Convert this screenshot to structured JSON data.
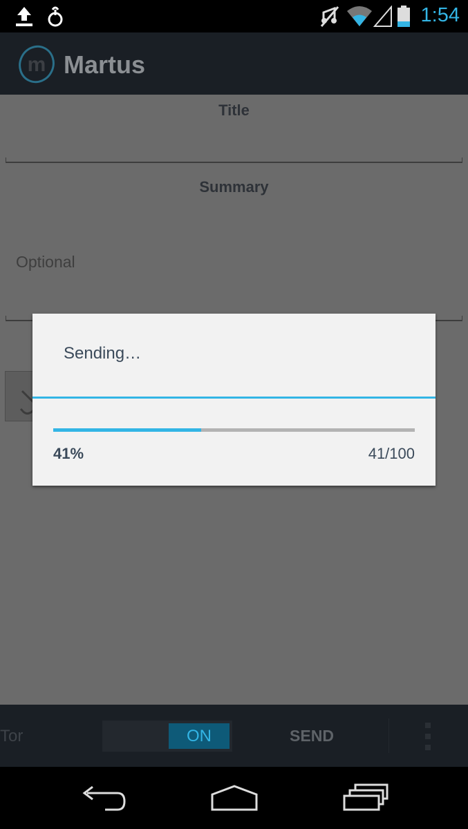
{
  "status_bar": {
    "time": "1:54",
    "icons": [
      "upload-icon",
      "usb-debug-icon",
      "mute-icon",
      "wifi-icon",
      "signal-icon",
      "battery-icon"
    ],
    "accent_color": "#33b5e5"
  },
  "action_bar": {
    "app_title": "Martus",
    "logo_letter": "m"
  },
  "form": {
    "title_label": "Title",
    "summary_label": "Summary",
    "summary_placeholder": "Optional",
    "attach_icon": "paperclip-icon"
  },
  "dialog": {
    "title": "Sending…",
    "progress_value": 41,
    "progress_max": 100,
    "progress_percent_text": "41%",
    "progress_count_text": "41/100"
  },
  "bottom_bar": {
    "tor_label": "Tor",
    "toggle_state": "ON",
    "send_label": "SEND",
    "overflow_icon": "overflow-menu-icon"
  },
  "nav_bar": {
    "icons": [
      "back-icon",
      "home-icon",
      "recent-apps-icon"
    ]
  }
}
